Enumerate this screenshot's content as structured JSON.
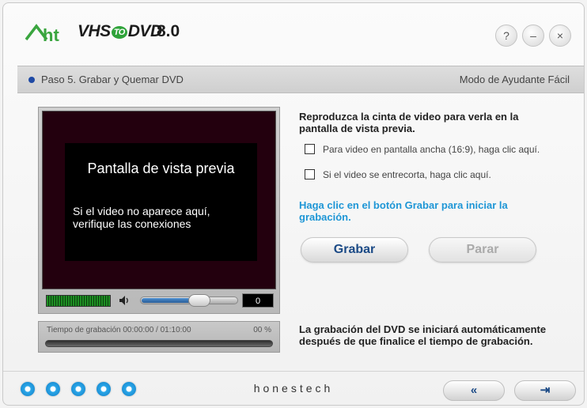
{
  "app": {
    "logo_text": "VHS",
    "logo_to": "TO",
    "logo_dvd": "DVD",
    "version": "8.0",
    "help_glyph": "?",
    "minimize_glyph": "–",
    "close_glyph": "×"
  },
  "step": {
    "label": "Paso 5. Grabar y Quemar DVD",
    "mode": "Modo de Ayudante Fácil"
  },
  "preview": {
    "title": "Pantalla de vista previa",
    "message": "Si el video no aparece aquí, verifique las conexiones",
    "counter": "0",
    "volume_level": 0.62
  },
  "recording": {
    "time_label": "Tiempo de grabación  00:00:00 / 01:10:00",
    "percent": "00 %",
    "progress": 0
  },
  "instructions": {
    "main": "Reproduzca la cinta de video para verla en la pantalla de vista previa.",
    "option_widescreen": "Para video en pantalla ancha (16:9), haga clic aquí.",
    "option_stutter": "Si el video se entrecorta, haga clic aquí.",
    "hint": "Haga clic en el botón Grabar para iniciar la grabación.",
    "footnote": "La grabación del DVD se iniciará automáticamente después de que finalice el tiempo de grabación."
  },
  "buttons": {
    "record": "Grabar",
    "stop": "Parar"
  },
  "footer": {
    "brand": "honestech",
    "back_glyph": "«",
    "exit_glyph": "⇥"
  },
  "colors": {
    "accent_blue": "#1e96d6",
    "button_text": "#1b4a86",
    "progress_dot": "#2aa6e8"
  },
  "icons": [
    "ht-logo-icon",
    "help-icon",
    "minimize-icon",
    "close-icon",
    "volume-icon",
    "back-icon",
    "exit-icon"
  ]
}
